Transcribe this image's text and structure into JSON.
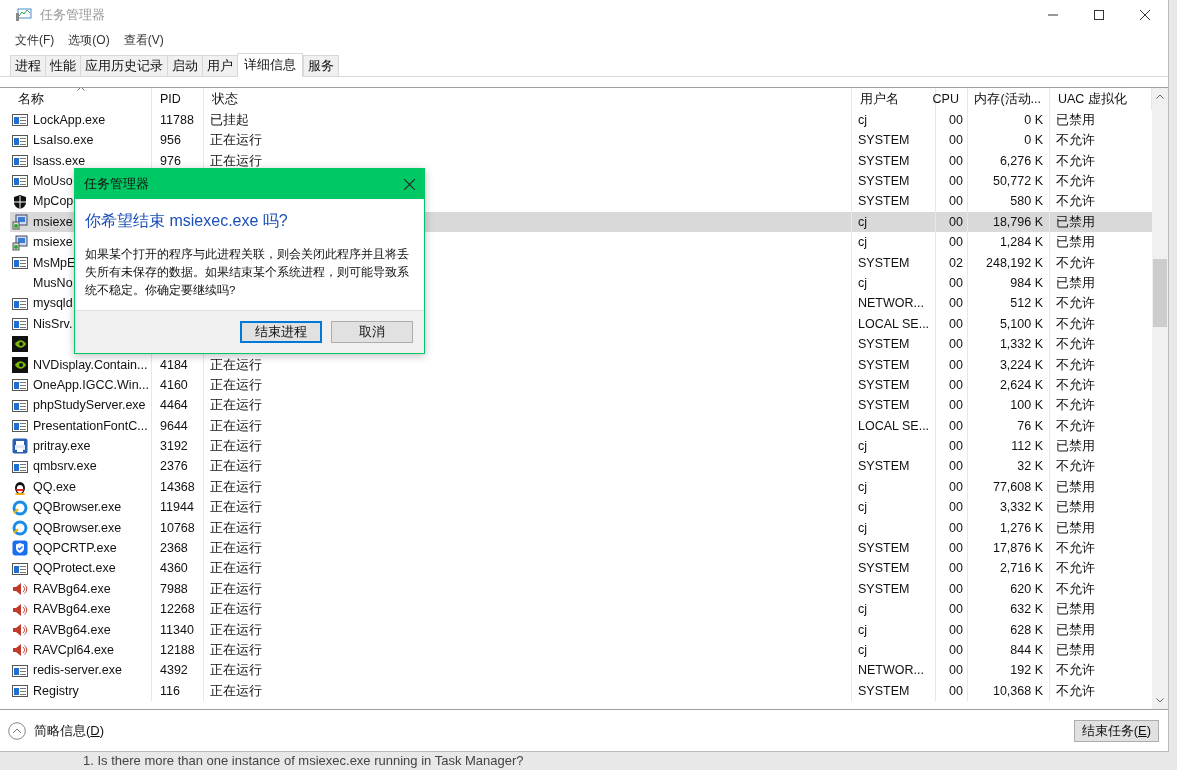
{
  "window": {
    "title": "任务管理器"
  },
  "menu": [
    "文件(F)",
    "选项(O)",
    "查看(V)"
  ],
  "tabs": [
    {
      "label": "进程",
      "selected": false
    },
    {
      "label": "性能",
      "selected": false
    },
    {
      "label": "应用历史记录",
      "selected": false
    },
    {
      "label": "启动",
      "selected": false
    },
    {
      "label": "用户",
      "selected": false
    },
    {
      "label": "详细信息",
      "selected": true
    },
    {
      "label": "服务",
      "selected": false
    }
  ],
  "table": {
    "columns": [
      "名称",
      "PID",
      "状态",
      "用户名",
      "CPU",
      "内存(活动...",
      "UAC 虚拟化"
    ],
    "rows": [
      {
        "kind": "app",
        "name": "LockApp.exe",
        "pid": "11788",
        "status": "已挂起",
        "user": "cj",
        "cpu": "00",
        "memory": "0 K",
        "uac": "已禁用",
        "selected": false
      },
      {
        "kind": "app",
        "name": "LsaIso.exe",
        "pid": "956",
        "status": "正在运行",
        "user": "SYSTEM",
        "cpu": "00",
        "memory": "0 K",
        "uac": "不允许",
        "selected": false
      },
      {
        "kind": "app",
        "name": "lsass.exe",
        "pid": "976",
        "status": "正在运行",
        "user": "SYSTEM",
        "cpu": "00",
        "memory": "6,276 K",
        "uac": "不允许",
        "selected": false
      },
      {
        "kind": "app",
        "name": "MoUso",
        "user": "SYSTEM",
        "cpu": "00",
        "memory": "50,772 K",
        "uac": "不允许",
        "selected": false
      },
      {
        "kind": "shield",
        "name": "MpCop",
        "user": "SYSTEM",
        "cpu": "00",
        "memory": "580 K",
        "uac": "不允许",
        "selected": false
      },
      {
        "kind": "installer",
        "name": "msiexe",
        "user": "cj",
        "cpu": "00",
        "memory": "18,796 K",
        "uac": "已禁用",
        "selected": true
      },
      {
        "kind": "installer",
        "name": "msiexe",
        "user": "cj",
        "cpu": "00",
        "memory": "1,284 K",
        "uac": "已禁用",
        "selected": false
      },
      {
        "kind": "app",
        "name": "MsMpE",
        "user": "SYSTEM",
        "cpu": "02",
        "memory": "248,192 K",
        "uac": "不允许",
        "selected": false
      },
      {
        "kind": "plain",
        "name": "MusNo",
        "user": "cj",
        "cpu": "00",
        "memory": "984 K",
        "uac": "已禁用",
        "selected": false
      },
      {
        "kind": "app",
        "name": "mysqld",
        "user": "NETWOR...",
        "cpu": "00",
        "memory": "512 K",
        "uac": "不允许",
        "selected": false
      },
      {
        "kind": "app",
        "name": "NisSrv.",
        "user": "LOCAL SE...",
        "cpu": "00",
        "memory": "5,100 K",
        "uac": "不允许",
        "selected": false
      },
      {
        "kind": "nvidia",
        "user": "SYSTEM",
        "cpu": "00",
        "memory": "1,332 K",
        "uac": "不允许",
        "selected": false
      },
      {
        "kind": "nvidia",
        "name": "NVDisplay.Contain...",
        "pid": "4184",
        "status": "正在运行",
        "user": "SYSTEM",
        "cpu": "00",
        "memory": "3,224 K",
        "uac": "不允许",
        "selected": false
      },
      {
        "kind": "app",
        "name": "OneApp.IGCC.Win...",
        "pid": "4160",
        "status": "正在运行",
        "user": "SYSTEM",
        "cpu": "00",
        "memory": "2,624 K",
        "uac": "不允许",
        "selected": false
      },
      {
        "kind": "app",
        "name": "phpStudyServer.exe",
        "pid": "4464",
        "status": "正在运行",
        "user": "SYSTEM",
        "cpu": "00",
        "memory": "100 K",
        "uac": "不允许",
        "selected": false
      },
      {
        "kind": "app",
        "name": "PresentationFontC...",
        "pid": "9644",
        "status": "正在运行",
        "user": "LOCAL SE...",
        "cpu": "00",
        "memory": "76 K",
        "uac": "不允许",
        "selected": false
      },
      {
        "kind": "printer",
        "name": "pritray.exe",
        "pid": "3192",
        "status": "正在运行",
        "user": "cj",
        "cpu": "00",
        "memory": "112 K",
        "uac": "已禁用",
        "selected": false
      },
      {
        "kind": "app",
        "name": "qmbsrv.exe",
        "pid": "2376",
        "status": "正在运行",
        "user": "SYSTEM",
        "cpu": "00",
        "memory": "32 K",
        "uac": "不允许",
        "selected": false
      },
      {
        "kind": "penguin",
        "name": "QQ.exe",
        "pid": "14368",
        "status": "正在运行",
        "user": "cj",
        "cpu": "00",
        "memory": "77,608 K",
        "uac": "已禁用",
        "selected": false
      },
      {
        "kind": "browser",
        "name": "QQBrowser.exe",
        "pid": "11944",
        "status": "正在运行",
        "user": "cj",
        "cpu": "00",
        "memory": "3,332 K",
        "uac": "已禁用",
        "selected": false
      },
      {
        "kind": "browser",
        "name": "QQBrowser.exe",
        "pid": "10768",
        "status": "正在运行",
        "user": "cj",
        "cpu": "00",
        "memory": "1,276 K",
        "uac": "已禁用",
        "selected": false
      },
      {
        "kind": "guard",
        "name": "QQPCRTP.exe",
        "pid": "2368",
        "status": "正在运行",
        "user": "SYSTEM",
        "cpu": "00",
        "memory": "17,876 K",
        "uac": "不允许",
        "selected": false
      },
      {
        "kind": "app",
        "name": "QQProtect.exe",
        "pid": "4360",
        "status": "正在运行",
        "user": "SYSTEM",
        "cpu": "00",
        "memory": "2,716 K",
        "uac": "不允许",
        "selected": false
      },
      {
        "kind": "speaker",
        "name": "RAVBg64.exe",
        "pid": "7988",
        "status": "正在运行",
        "user": "SYSTEM",
        "cpu": "00",
        "memory": "620 K",
        "uac": "不允许",
        "selected": false
      },
      {
        "kind": "speaker",
        "name": "RAVBg64.exe",
        "pid": "12268",
        "status": "正在运行",
        "user": "cj",
        "cpu": "00",
        "memory": "632 K",
        "uac": "已禁用",
        "selected": false
      },
      {
        "kind": "speaker",
        "name": "RAVBg64.exe",
        "pid": "11340",
        "status": "正在运行",
        "user": "cj",
        "cpu": "00",
        "memory": "628 K",
        "uac": "已禁用",
        "selected": false
      },
      {
        "kind": "speaker",
        "name": "RAVCpl64.exe",
        "pid": "12188",
        "status": "正在运行",
        "user": "cj",
        "cpu": "00",
        "memory": "844 K",
        "uac": "已禁用",
        "selected": false
      },
      {
        "kind": "app",
        "name": "redis-server.exe",
        "pid": "4392",
        "status": "正在运行",
        "user": "NETWOR...",
        "cpu": "00",
        "memory": "192 K",
        "uac": "不允许",
        "selected": false
      },
      {
        "kind": "app",
        "name": "Registry",
        "pid": "116",
        "status": "正在运行",
        "user": "SYSTEM",
        "cpu": "00",
        "memory": "10,368 K",
        "uac": "不允许",
        "selected": false
      }
    ]
  },
  "dialog": {
    "title": "任务管理器",
    "heading": "你希望结束 msiexec.exe 吗?",
    "message": "如果某个打开的程序与此进程关联，则会关闭此程序并且将丢失所有未保存的数据。如果结束某个系统进程，则可能导致系统不稳定。你确定要继续吗?",
    "buttons": [
      {
        "label": "结束进程",
        "selected": true
      },
      {
        "label": "取消",
        "selected": false
      }
    ]
  },
  "footer": {
    "details_toggle": [
      "简略信息(",
      "D",
      ")"
    ],
    "end_task": [
      "结束任务(",
      "E",
      ")"
    ]
  },
  "background_text": "1. Is there more than one instance of msiexec.exe running in Task Manager?"
}
